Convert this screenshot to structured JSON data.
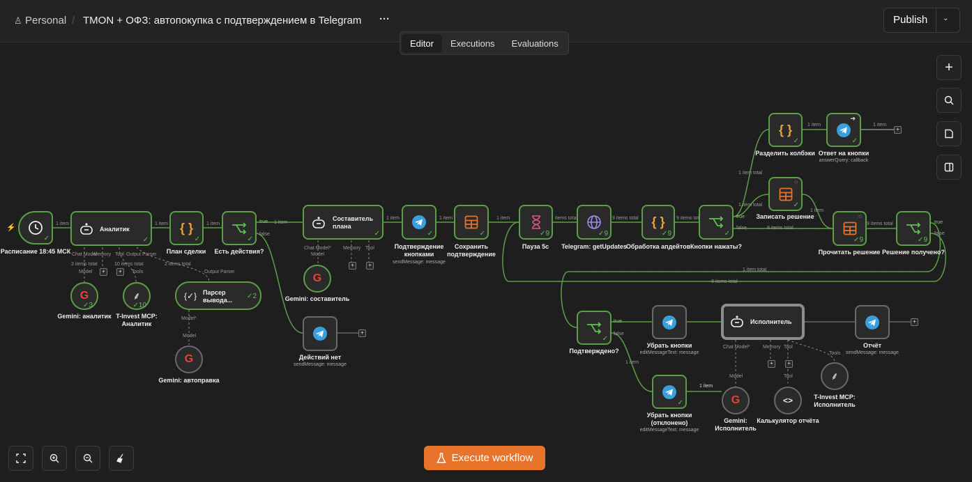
{
  "header": {
    "workspace": "Personal",
    "separator": "/",
    "workflow_title": "TMON + ОФЗ: автопокупка с подтверждением в Telegram",
    "more": "···",
    "publish_label": "Publish"
  },
  "tabs": [
    {
      "label": "Editor",
      "active": true
    },
    {
      "label": "Executions",
      "active": false
    },
    {
      "label": "Evaluations",
      "active": false
    }
  ],
  "nodes": {
    "schedule": {
      "label": "Расписание 18:45 МСК"
    },
    "analyst": {
      "title": "Аналитик",
      "label": "Аналитик"
    },
    "plan": {
      "label": "План сделки"
    },
    "has_actions": {
      "label": "Есть действия?"
    },
    "composer": {
      "title1": "Составитель",
      "title2": "плана"
    },
    "confirm_buttons": {
      "label1": "Подтверждение",
      "label2": "кнопками",
      "sub": "sendMessage: message"
    },
    "save_confirm": {
      "label1": "Сохранить",
      "label2": "подтверждение"
    },
    "pause": {
      "label": "Пауза 5с",
      "badge": "9"
    },
    "get_updates": {
      "label": "Telegram: getUpdates",
      "badge": "9"
    },
    "process_updates": {
      "label": "Обработка апдейтов",
      "badge": "9"
    },
    "buttons_pressed": {
      "label": "Кнопки нажаты?"
    },
    "split_callbacks": {
      "label": "Разделить колбэки"
    },
    "answer_buttons": {
      "label": "Ответ на кнопки",
      "sub": "answerQuery: callback"
    },
    "record_decision": {
      "label": "Записать решение"
    },
    "read_decision": {
      "label": "Прочитать решение",
      "badge": "9"
    },
    "decision_received": {
      "label": "Решение получено?",
      "badge": "9"
    },
    "no_actions": {
      "label": "Действий нет",
      "sub": "sendMessage: message"
    },
    "parser": {
      "title1": "Парсер",
      "title2": "вывода...",
      "badge": "2"
    },
    "gemini_analyst": {
      "label": "Gemini: аналитик",
      "badge": "3"
    },
    "tinvest_analyst": {
      "label1": "T-Invest MCP:",
      "label2": "Аналитик",
      "badge": "10"
    },
    "gemini_composer": {
      "label": "Gemini: составитель"
    },
    "gemini_autofix": {
      "label": "Gemini: автоправка"
    },
    "confirmed": {
      "label": "Подтверждено?"
    },
    "remove_buttons": {
      "label": "Убрать кнопки",
      "sub": "editMessageText: message"
    },
    "executor": {
      "title": "Исполнитель"
    },
    "report": {
      "label": "Отчёт",
      "sub": "sendMessage: message"
    },
    "remove_buttons_rej": {
      "label1": "Убрать кнопки",
      "label2": "(отклонено)",
      "sub": "editMessageText: message"
    },
    "gemini_executor": {
      "label1": "Gemini:",
      "label2": "Исполнитель"
    },
    "calc_report": {
      "label": "Калькулятор отчёта"
    },
    "tinvest_executor": {
      "label1": "T-Invest MCP:",
      "label2": "Исполнитель"
    }
  },
  "edge_labels": {
    "one_item": "1 item",
    "items_total_3": "3 items total",
    "items_total_10": "10 items total",
    "items_total_2": "2 items total",
    "items_total_1": "1 item total",
    "items_total_9": "9 items total",
    "items_total_8": "8 items total",
    "items_total_ru": "items total",
    "true": "true",
    "false": "false"
  },
  "port_labels": {
    "chat_model": "Chat Model",
    "memory": "Memory",
    "tool": "Tool",
    "output_parser": "Output Parser",
    "model": "Model",
    "tools": "Tools",
    "chat_model_req": "Chat Model*",
    "model_req": "Model*"
  },
  "controls": {
    "execute_label": "Execute workflow"
  },
  "colors": {
    "success_border": "#5c9e47",
    "accent_button": "#e8742c",
    "canvas_bg": "#1e1e1e"
  }
}
